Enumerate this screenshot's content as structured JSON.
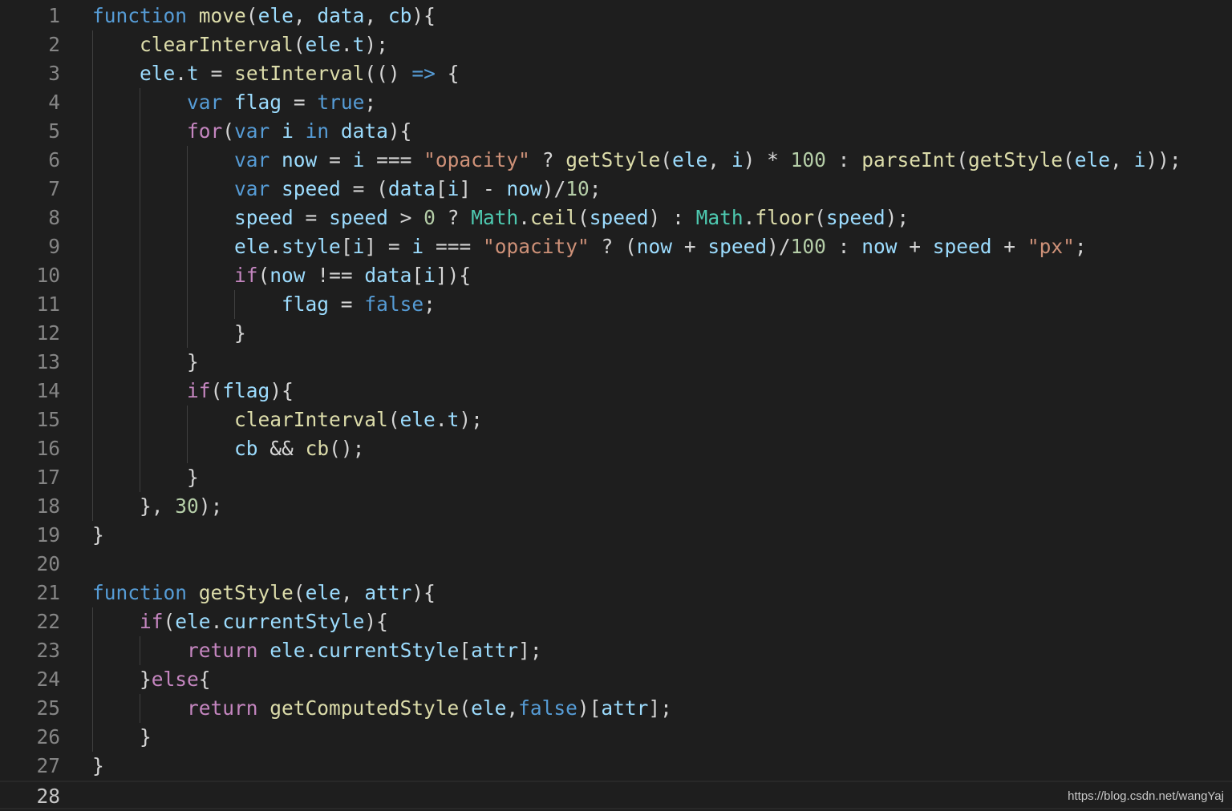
{
  "editor": {
    "language": "javascript",
    "current_line": 28,
    "theme_colors": {
      "background": "#1e1e1e",
      "keyword": "#569cd6",
      "control": "#c586c0",
      "function": "#dcdcaa",
      "variable": "#9cdcfe",
      "string": "#ce9178",
      "number": "#b5cea8",
      "line_number": "#858585"
    },
    "lines": [
      {
        "n": "1",
        "text": "function move(ele, data, cb){"
      },
      {
        "n": "2",
        "text": "    clearInterval(ele.t);"
      },
      {
        "n": "3",
        "text": "    ele.t = setInterval(() => {"
      },
      {
        "n": "4",
        "text": "        var flag = true;"
      },
      {
        "n": "5",
        "text": "        for(var i in data){"
      },
      {
        "n": "6",
        "text": "            var now = i === \"opacity\" ? getStyle(ele, i) * 100 : parseInt(getStyle(ele, i));"
      },
      {
        "n": "7",
        "text": "            var speed = (data[i] - now)/10;"
      },
      {
        "n": "8",
        "text": "            speed = speed > 0 ? Math.ceil(speed) : Math.floor(speed);"
      },
      {
        "n": "9",
        "text": "            ele.style[i] = i === \"opacity\" ? (now + speed)/100 : now + speed + \"px\";"
      },
      {
        "n": "10",
        "text": "            if(now !== data[i]){"
      },
      {
        "n": "11",
        "text": "                flag = false;"
      },
      {
        "n": "12",
        "text": "            }"
      },
      {
        "n": "13",
        "text": "        }"
      },
      {
        "n": "14",
        "text": "        if(flag){"
      },
      {
        "n": "15",
        "text": "            clearInterval(ele.t);"
      },
      {
        "n": "16",
        "text": "            cb && cb();"
      },
      {
        "n": "17",
        "text": "        }"
      },
      {
        "n": "18",
        "text": "    }, 30);"
      },
      {
        "n": "19",
        "text": "}"
      },
      {
        "n": "20",
        "text": ""
      },
      {
        "n": "21",
        "text": "function getStyle(ele, attr){"
      },
      {
        "n": "22",
        "text": "    if(ele.currentStyle){"
      },
      {
        "n": "23",
        "text": "        return ele.currentStyle[attr];"
      },
      {
        "n": "24",
        "text": "    }else{"
      },
      {
        "n": "25",
        "text": "        return getComputedStyle(ele,false)[attr];"
      },
      {
        "n": "26",
        "text": "    }"
      },
      {
        "n": "27",
        "text": "}"
      },
      {
        "n": "28",
        "text": ""
      }
    ]
  },
  "watermark": "https://blog.csdn.net/wangYaj"
}
